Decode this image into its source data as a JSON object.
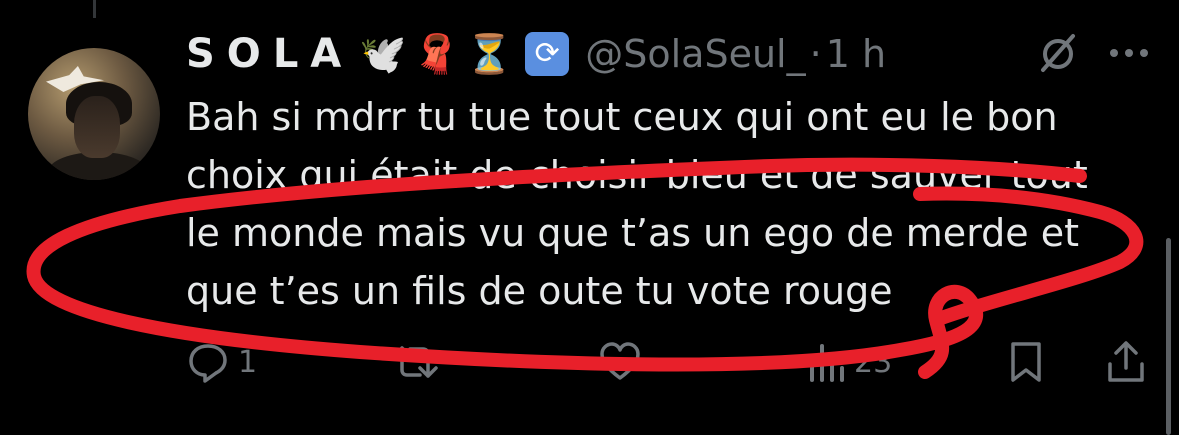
{
  "tweet": {
    "display_name": "SOLA",
    "name_emojis": [
      "🕊️",
      "🧣",
      "⏳",
      "🔄"
    ],
    "handle": "@SolaSeul_",
    "separator": "·",
    "timestamp": "1 h",
    "text_lines": [
      "Bah si mdrr tu tue tout ceux qui ont eu le bon",
      "choix qui était de choisir bleu et de sauver tout",
      "le monde mais vu que t’as un ego de merde et",
      "que t’es un fils de oute tu vote rouge"
    ],
    "actions": {
      "reply_count": "1",
      "retweet_count": "",
      "like_count": "",
      "views_count": "23"
    }
  },
  "icons": {
    "grok": "grok-icon",
    "more": "more-icon",
    "reply": "reply-icon",
    "retweet": "retweet-icon",
    "like": "like-icon",
    "views": "views-icon",
    "bookmark": "bookmark-icon",
    "share": "share-icon"
  },
  "colors": {
    "background": "#000000",
    "text_primary": "#e7e9ea",
    "text_secondary": "#71767b",
    "scribble": "#e8202a"
  }
}
